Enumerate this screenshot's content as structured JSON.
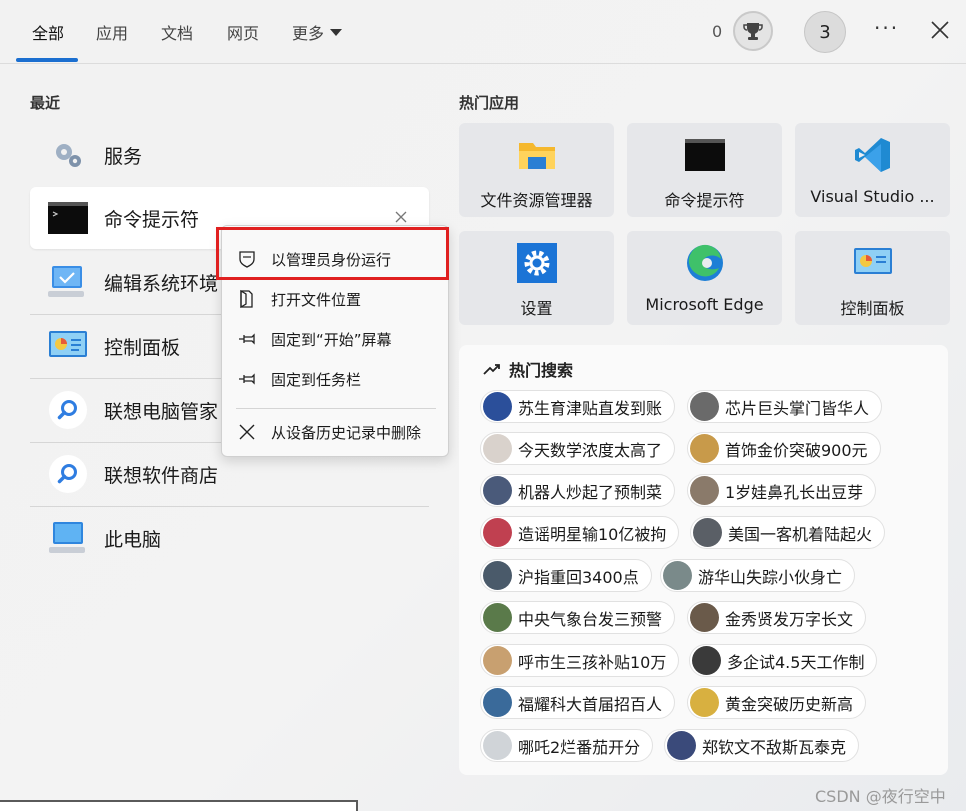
{
  "tabs": [
    {
      "label": "全部"
    },
    {
      "label": "应用"
    },
    {
      "label": "文档"
    },
    {
      "label": "网页"
    },
    {
      "label": "更多"
    }
  ],
  "header": {
    "points": "0",
    "avatar_letter": "3",
    "more_label": "···"
  },
  "recent": {
    "title": "最近",
    "items": [
      {
        "label": "服务",
        "icon": "gears-icon"
      },
      {
        "label": "命令提示符",
        "icon": "cmd-icon"
      },
      {
        "label": "编辑系统环境",
        "icon": "monitor-check-icon"
      },
      {
        "label": "控制面板",
        "icon": "control-panel-icon"
      },
      {
        "label": "联想电脑管家",
        "icon": "search-app-icon"
      },
      {
        "label": "联想软件商店",
        "icon": "search-app-icon"
      },
      {
        "label": "此电脑",
        "icon": "computer-icon"
      }
    ]
  },
  "context_menu": {
    "items": [
      {
        "label": "以管理员身份运行",
        "icon": "shield-icon"
      },
      {
        "label": "打开文件位置",
        "icon": "folder-open-icon"
      },
      {
        "label": "固定到“开始”屏幕",
        "icon": "pin-icon"
      },
      {
        "label": "固定到任务栏",
        "icon": "pin-icon"
      },
      {
        "label": "从设备历史记录中删除",
        "icon": "close-icon"
      }
    ]
  },
  "hot_apps": {
    "title": "热门应用",
    "items": [
      {
        "label": "文件资源管理器",
        "icon": "file-explorer-icon"
      },
      {
        "label": "命令提示符",
        "icon": "cmd-icon"
      },
      {
        "label": "Visual Studio ...",
        "icon": "vscode-icon"
      },
      {
        "label": "设置",
        "icon": "settings-icon"
      },
      {
        "label": "Microsoft Edge",
        "icon": "edge-icon"
      },
      {
        "label": "控制面板",
        "icon": "control-panel-icon"
      }
    ]
  },
  "hot_search": {
    "title": "热门搜索",
    "items": [
      {
        "text": "苏生育津贴直发到账",
        "color": "#2b4f9a"
      },
      {
        "text": "芯片巨头掌门皆华人",
        "color": "#6a6a6a"
      },
      {
        "text": "今天数学浓度太高了",
        "color": "#d9d2cc"
      },
      {
        "text": "首饰金价突破900元",
        "color": "#c89a4a"
      },
      {
        "text": "机器人炒起了预制菜",
        "color": "#4a5a7a"
      },
      {
        "text": "1岁娃鼻孔长出豆芽",
        "color": "#8a7a6a"
      },
      {
        "text": "造谣明星输10亿被拘",
        "color": "#c04050"
      },
      {
        "text": "美国一客机着陆起火",
        "color": "#5a5f66"
      },
      {
        "text": "沪指重回3400点",
        "color": "#4a5a6a"
      },
      {
        "text": "游华山失踪小伙身亡",
        "color": "#7a8a8a"
      },
      {
        "text": "中央气象台发三预警",
        "color": "#5a7a4a"
      },
      {
        "text": "金秀贤发万字长文",
        "color": "#6a5a4a"
      },
      {
        "text": "呼市生三孩补贴10万",
        "color": "#c8a070"
      },
      {
        "text": "多企试4.5天工作制",
        "color": "#3a3a3a"
      },
      {
        "text": "福耀科大首届招百人",
        "color": "#3a6a9a"
      },
      {
        "text": "黄金突破历史新高",
        "color": "#d8b040"
      },
      {
        "text": "哪吒2烂番茄开分",
        "color": "#d0d4d8"
      },
      {
        "text": "郑钦文不敌斯瓦泰克",
        "color": "#3a4a7a"
      }
    ]
  },
  "watermark": "CSDN @夜行空中"
}
